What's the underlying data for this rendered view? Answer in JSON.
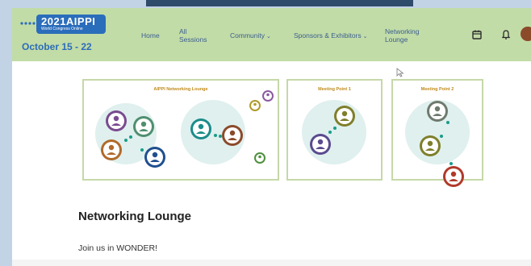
{
  "header": {
    "logo": {
      "year": "2021AIPPI",
      "subtitle": "World Congress Online",
      "dates": "October 15 - 22"
    },
    "nav": [
      {
        "label": "Home"
      },
      {
        "label": "All Sessions"
      },
      {
        "label": "Community",
        "dropdown": true
      },
      {
        "label": "Sponsors & Exhibitors",
        "dropdown": true
      },
      {
        "label": "Networking Lounge"
      }
    ],
    "icons": [
      "calendar-icon",
      "bell-icon"
    ]
  },
  "banners": [
    {
      "title": "AIPPI Networking Lounge"
    },
    {
      "title": "Meeting Point 1"
    },
    {
      "title": "Meeting Point 2"
    }
  ],
  "content": {
    "title": "Networking Lounge",
    "subtitle": "Join us in WONDER!"
  },
  "colors": {
    "header": "#c2dca7",
    "nav_text": "#3b5e8e",
    "brand_blue": "#2a6dbb",
    "banner_border": "#c6d8a8",
    "bubble": "#dff0ee",
    "connector": "#1b9c8a"
  }
}
